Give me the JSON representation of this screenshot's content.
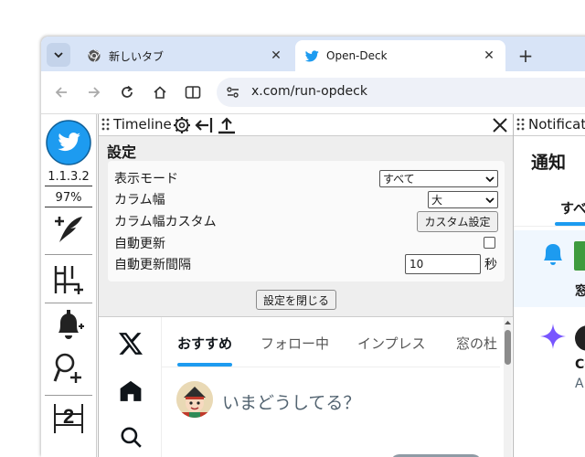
{
  "browser": {
    "tabs": [
      {
        "title": "新しいタブ",
        "icon": "chrome-icon",
        "active": false
      },
      {
        "title": "Open-Deck",
        "icon": "twitter-bird-icon",
        "active": true
      }
    ],
    "url": "x.com/run-opdeck"
  },
  "sidebar": {
    "version": "1.1.3.2",
    "zoom": "97%",
    "buttons": [
      "compose-icon",
      "add-column-icon",
      "notification-bell-icon",
      "search-add-icon",
      "column-number-icon"
    ],
    "column_number": "2"
  },
  "timeline_column": {
    "title": "Timeline",
    "settings": {
      "title": "設定",
      "rows": [
        {
          "label": "表示モード",
          "control": "select",
          "value": "すべて"
        },
        {
          "label": "カラム幅",
          "control": "select",
          "value": "大"
        },
        {
          "label": "カラム幅カスタム",
          "control": "button",
          "value": "カスタム設定"
        },
        {
          "label": "自動更新",
          "control": "checkbox",
          "checked": false
        },
        {
          "label": "自動更新間隔",
          "control": "number",
          "value": "10",
          "unit": "秒"
        }
      ],
      "close_label": "設定を閉じる"
    },
    "x_tabs": [
      "おすすめ",
      "フォロー中",
      "インプレス",
      "窓の杜"
    ],
    "compose_placeholder": "いまどうしてる？"
  },
  "notifications_column": {
    "title": "Notificat",
    "page_title": "通知",
    "tab": "すべ",
    "notif_text": "窓",
    "notif2_text1": "Co",
    "notif2_text2": "A"
  },
  "colors": {
    "accent_blue": "#1d9bf0",
    "tabstrip": "#d8e4f7",
    "purple_star": "#7856ff"
  }
}
